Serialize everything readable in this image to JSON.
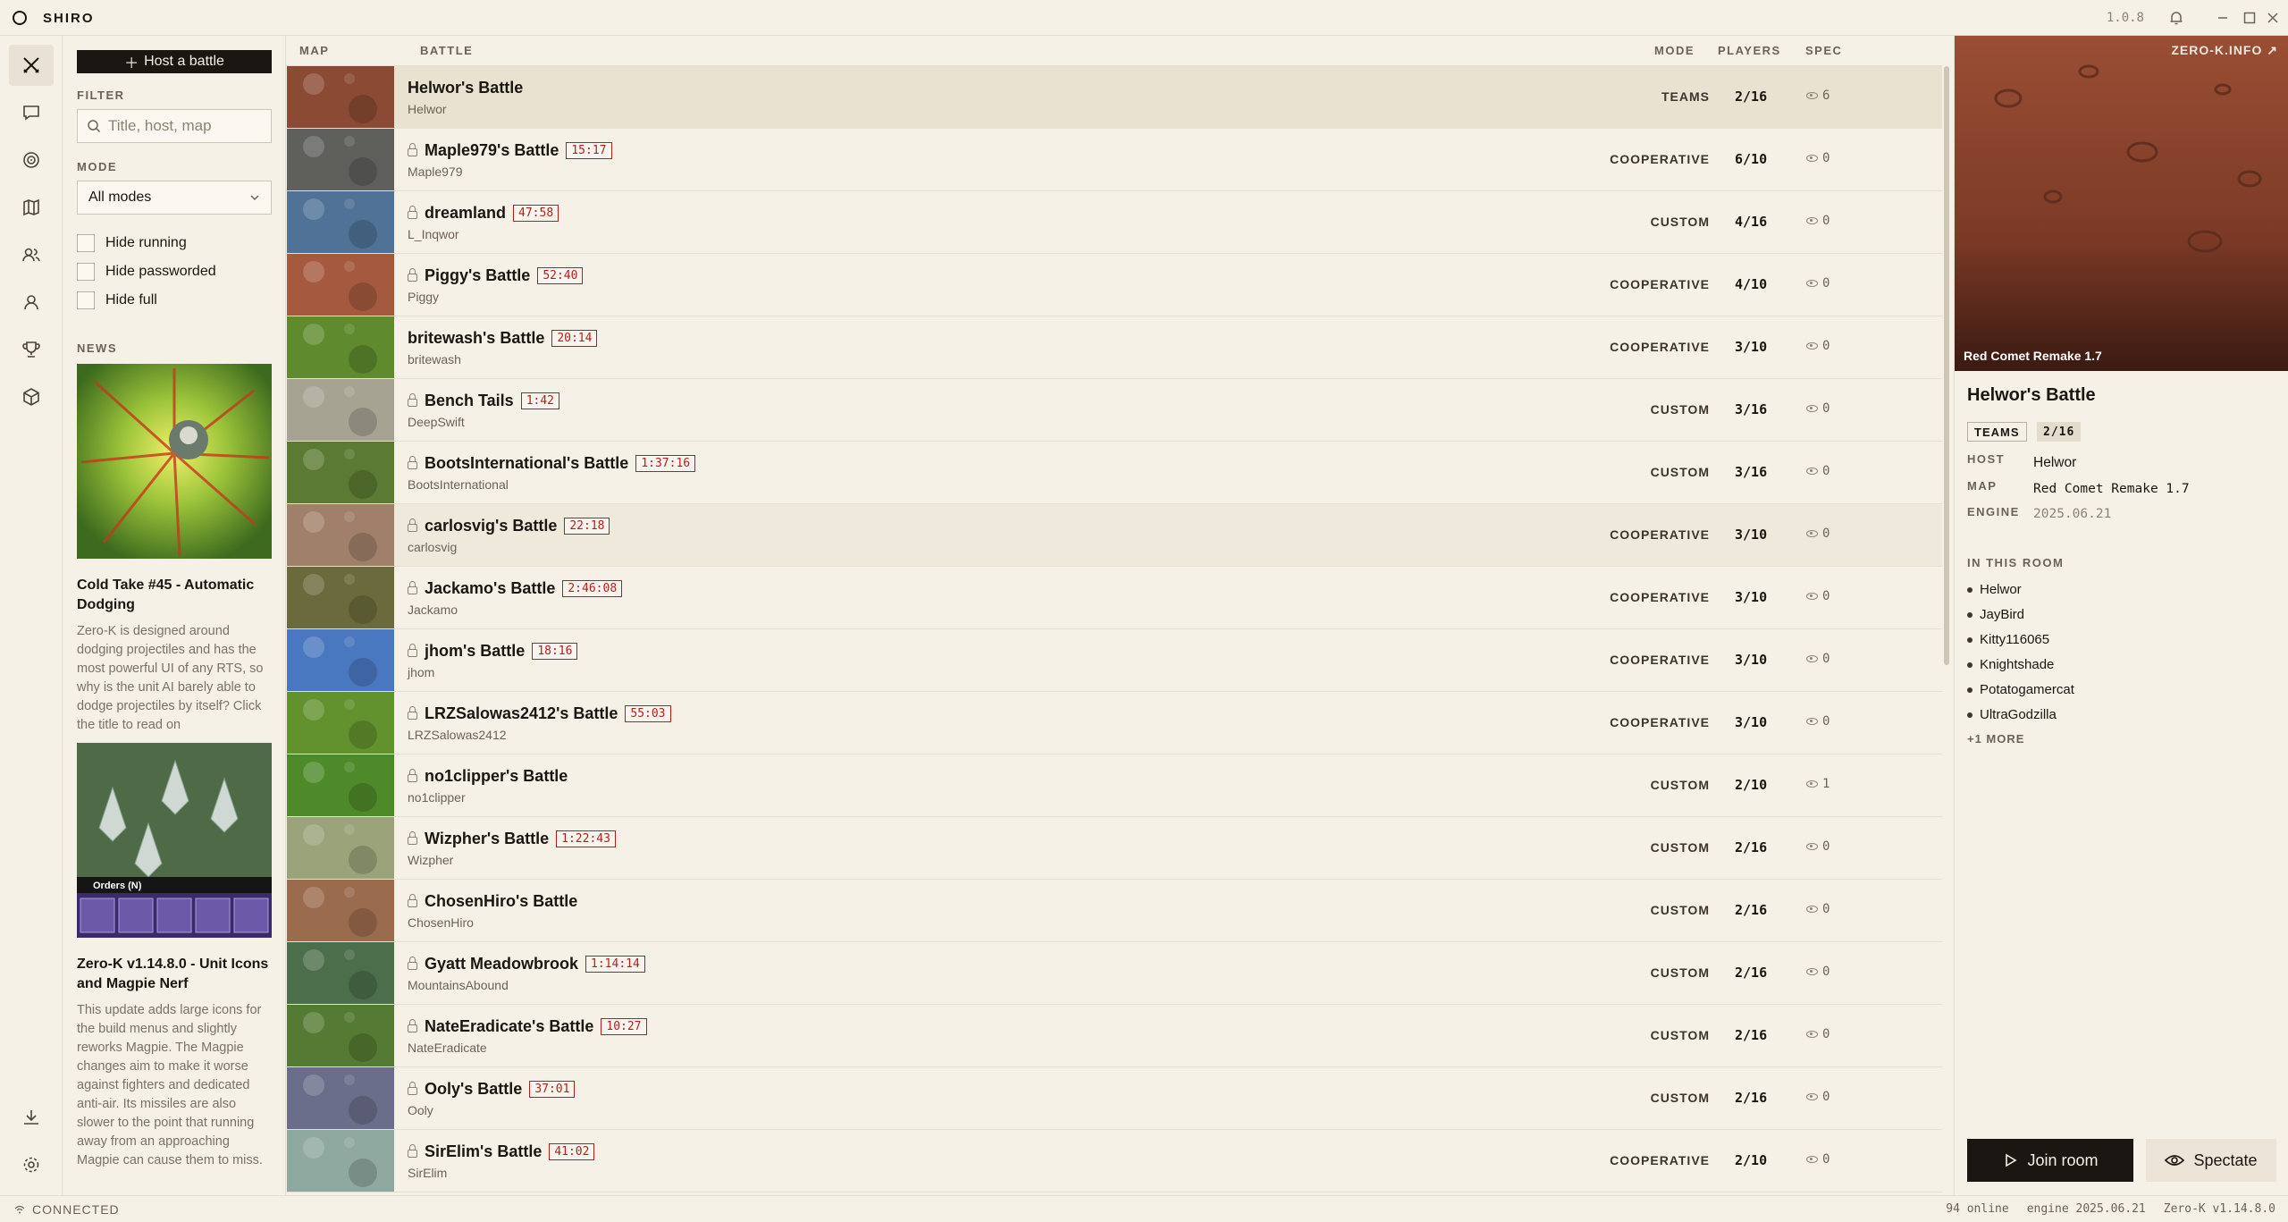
{
  "app": {
    "name": "SHIRO",
    "version": "1.0.8"
  },
  "filters": {
    "host_button": "Host a battle",
    "filter_label": "FILTER",
    "search_placeholder": "Title, host, map",
    "mode_label": "MODE",
    "mode_value": "All modes",
    "checks": [
      "Hide running",
      "Hide passworded",
      "Hide full"
    ],
    "news_label": "NEWS"
  },
  "news": [
    {
      "title": "Cold Take #45 - Automatic Dodging",
      "body": "Zero-K is designed around dodging projectiles and has the most powerful UI of any RTS, so why is the unit AI barely able to dodge projectiles by itself? Click the title to read on"
    },
    {
      "title": "Zero-K v1.14.8.0 - Unit Icons and Magpie Nerf",
      "body": "This update adds large icons for the build menus and slightly reworks Magpie. The Magpie changes aim to make it worse against fighters and dedicated anti-air. Its missiles are also slower to the point that running away from an approaching Magpie can cause them to miss.",
      "overlay_label": "Orders (N)"
    }
  ],
  "list_headers": {
    "map": "MAP",
    "battle": "BATTLE",
    "mode": "MODE",
    "players": "PLAYERS",
    "spec": "SPEC"
  },
  "battles": [
    {
      "name": "Helwor's Battle",
      "host": "Helwor",
      "timer": "",
      "locked": false,
      "mode": "TEAMS",
      "players": "2/16",
      "spec": "6",
      "map_color": "#8a4a33"
    },
    {
      "name": "Maple979's Battle",
      "host": "Maple979",
      "timer": "15:17",
      "locked": true,
      "mode": "COOPERATIVE",
      "players": "6/10",
      "spec": "0",
      "map_color": "#5f5f5c"
    },
    {
      "name": "dreamland",
      "host": "L_Inqwor",
      "timer": "47:58",
      "locked": true,
      "mode": "CUSTOM",
      "players": "4/16",
      "spec": "0",
      "map_color": "#4f7296"
    },
    {
      "name": "Piggy's Battle",
      "host": "Piggy",
      "timer": "52:40",
      "locked": true,
      "mode": "COOPERATIVE",
      "players": "4/10",
      "spec": "0",
      "map_color": "#a55a3f"
    },
    {
      "name": "britewash's Battle",
      "host": "britewash",
      "timer": "20:14",
      "locked": false,
      "mode": "COOPERATIVE",
      "players": "3/10",
      "spec": "0",
      "map_color": "#5f8a2e"
    },
    {
      "name": "Bench Tails",
      "host": "DeepSwift",
      "timer": "1:42",
      "locked": true,
      "mode": "CUSTOM",
      "players": "3/16",
      "spec": "0",
      "map_color": "#a7a393"
    },
    {
      "name": "BootsInternational's Battle",
      "host": "BootsInternational",
      "timer": "1:37:16",
      "locked": true,
      "mode": "CUSTOM",
      "players": "3/16",
      "spec": "0",
      "map_color": "#5b7a33"
    },
    {
      "name": "carlosvig's Battle",
      "host": "carlosvig",
      "timer": "22:18",
      "locked": true,
      "mode": "COOPERATIVE",
      "players": "3/10",
      "spec": "0",
      "map_color": "#a0806a"
    },
    {
      "name": "Jackamo's Battle",
      "host": "Jackamo",
      "timer": "2:46:08",
      "locked": true,
      "mode": "COOPERATIVE",
      "players": "3/10",
      "spec": "0",
      "map_color": "#6b6a3c"
    },
    {
      "name": "jhom's Battle",
      "host": "jhom",
      "timer": "18:16",
      "locked": true,
      "mode": "COOPERATIVE",
      "players": "3/10",
      "spec": "0",
      "map_color": "#4a78c0"
    },
    {
      "name": "LRZSalowas2412's Battle",
      "host": "LRZSalowas2412",
      "timer": "55:03",
      "locked": true,
      "mode": "COOPERATIVE",
      "players": "3/10",
      "spec": "0",
      "map_color": "#62922e"
    },
    {
      "name": "no1clipper's Battle",
      "host": "no1clipper",
      "timer": "",
      "locked": true,
      "mode": "CUSTOM",
      "players": "2/10",
      "spec": "1",
      "map_color": "#4e8a2a"
    },
    {
      "name": "Wizpher's Battle",
      "host": "Wizpher",
      "timer": "1:22:43",
      "locked": true,
      "mode": "CUSTOM",
      "players": "2/16",
      "spec": "0",
      "map_color": "#9aa37a"
    },
    {
      "name": "ChosenHiro's Battle",
      "host": "ChosenHiro",
      "timer": "",
      "locked": true,
      "mode": "CUSTOM",
      "players": "2/16",
      "spec": "0",
      "map_color": "#9b6b4e"
    },
    {
      "name": "Gyatt Meadowbrook",
      "host": "MountainsAbound",
      "timer": "1:14:14",
      "locked": true,
      "mode": "CUSTOM",
      "players": "2/16",
      "spec": "0",
      "map_color": "#4d6e4a"
    },
    {
      "name": "NateEradicate's Battle",
      "host": "NateEradicate",
      "timer": "10:27",
      "locked": true,
      "mode": "CUSTOM",
      "players": "2/16",
      "spec": "0",
      "map_color": "#557a33"
    },
    {
      "name": "Ooly's Battle",
      "host": "Ooly",
      "timer": "37:01",
      "locked": true,
      "mode": "CUSTOM",
      "players": "2/16",
      "spec": "0",
      "map_color": "#6a6e8a"
    },
    {
      "name": "SirElim's Battle",
      "host": "SirElim",
      "timer": "41:02",
      "locked": true,
      "mode": "COOPERATIVE",
      "players": "2/10",
      "spec": "0",
      "map_color": "#8fa8a0"
    }
  ],
  "detail": {
    "ext_link": "ZERO-K.INFO ↗",
    "map_caption": "Red Comet Remake 1.7",
    "title": "Helwor's Battle",
    "tags": [
      "TEAMS",
      "2/16"
    ],
    "host_label": "HOST",
    "host": "Helwor",
    "map_label": "MAP",
    "map": "Red Comet Remake 1.7",
    "engine_label": "ENGINE",
    "engine": "2025.06.21",
    "room_label": "IN THIS ROOM",
    "members": [
      "Helwor",
      "JayBird",
      "Kitty116065",
      "Knightshade",
      "Potatogamercat",
      "UltraGodzilla"
    ],
    "more": "+1 MORE",
    "join": "Join room",
    "spectate": "Spectate"
  },
  "status": {
    "connection": "CONNECTED",
    "online": "94 online",
    "engine": "engine 2025.06.21",
    "game": "Zero-K v1.14.8.0"
  },
  "colors": {
    "accent": "#1a1612",
    "background": "#f6f1e6",
    "timer": "#b3201c",
    "selected_row": "#e9e2d1"
  }
}
